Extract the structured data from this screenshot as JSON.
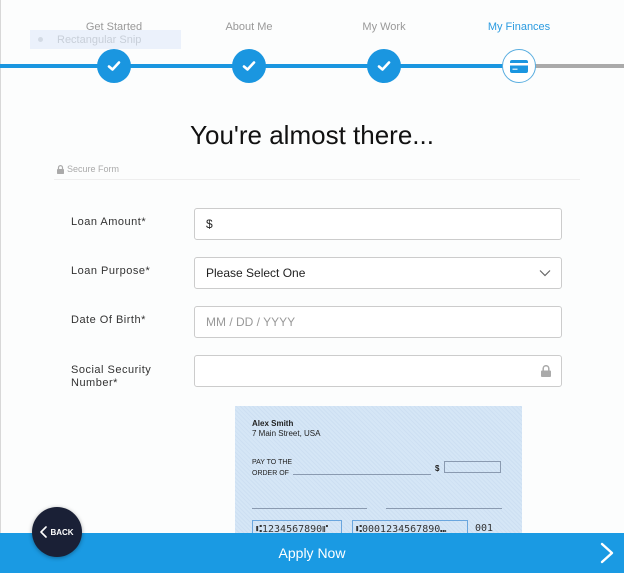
{
  "stepper": {
    "steps": [
      {
        "label": "Get Started",
        "state": "done",
        "icon": "check-icon"
      },
      {
        "label": "About Me",
        "state": "done",
        "icon": "check-icon"
      },
      {
        "label": "My Work",
        "state": "done",
        "icon": "check-icon"
      },
      {
        "label": "My Finances",
        "state": "current",
        "icon": "credit-card-icon"
      }
    ]
  },
  "overlay": {
    "snip_label": "Rectangular Snip"
  },
  "page": {
    "title": "You're almost there...",
    "secure_label": "Secure Form"
  },
  "form": {
    "loan_amount": {
      "label": "Loan Amount*",
      "prefix": "$",
      "value": ""
    },
    "loan_purpose": {
      "label": "Loan Purpose*",
      "selected": "Please Select One"
    },
    "date_of_birth": {
      "label": "Date Of Birth*",
      "placeholder": "MM / DD / YYYY",
      "value": ""
    },
    "ssn": {
      "label_line1": "Social Security",
      "label_line2": "Number*",
      "value": ""
    }
  },
  "check": {
    "name": "Alex Smith",
    "address": "7 Main Street, USA",
    "pay_to_line1": "PAY TO THE",
    "pay_to_line2": "ORDER OF",
    "dollar": "$",
    "routing": "⑆1234567890⑈",
    "account": "⑆0001234567890⑉",
    "check_number": "001"
  },
  "footer": {
    "apply_label": "Apply Now",
    "back_label": "BACK"
  },
  "colors": {
    "accent": "#1a96e0",
    "inactive_track": "#aaaaaa",
    "back_button": "#1a2036"
  }
}
